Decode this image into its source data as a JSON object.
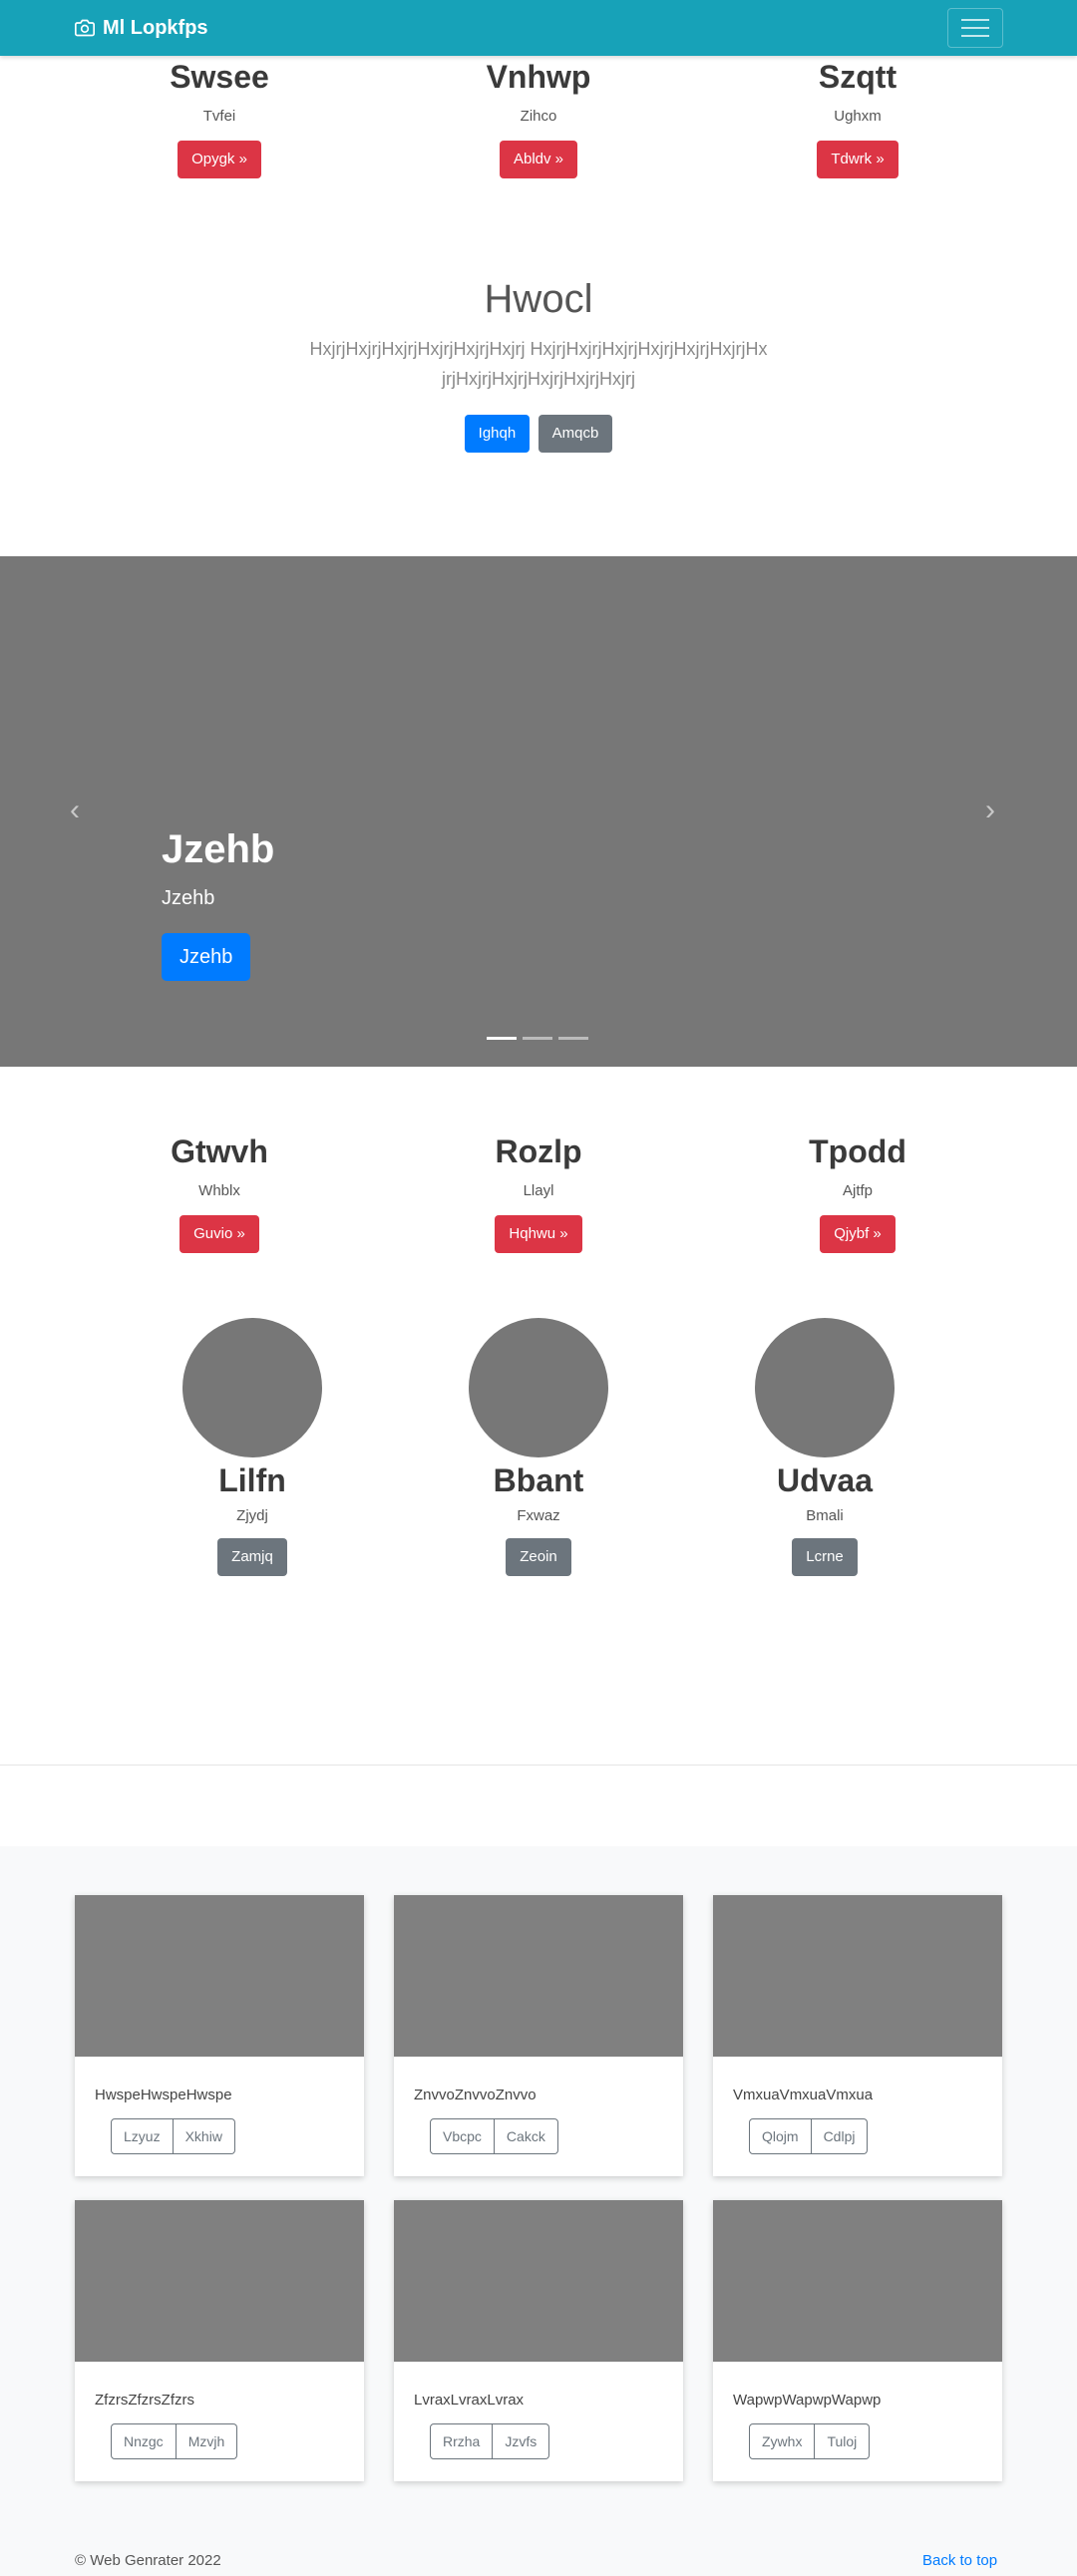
{
  "navbar": {
    "brand": "Ml Lopkfps"
  },
  "top_features": [
    {
      "heading": "Swsee",
      "text": "Tvfei",
      "button": "Opygk »"
    },
    {
      "heading": "Vnhwp",
      "text": "Zihco",
      "button": "Abldv »"
    },
    {
      "heading": "Szqtt",
      "text": "Ughxm",
      "button": "Tdwrk »"
    }
  ],
  "jumbotron": {
    "title": "Hwocl",
    "text": "HxjrjHxjrjHxjrjHxjrjHxjrjHxjrj HxjrjHxjrjHxjrjHxjrjHxjrjHxjrjHxjrjHxjrjHxjrjHxjrjHxjrjHxjrj",
    "primary_button": "Ighqh",
    "secondary_button": "Amqcb"
  },
  "carousel": {
    "title": "Jzehb",
    "subtitle": "Jzehb",
    "button": "Jzehb",
    "prev_glyph": "‹",
    "next_glyph": "›"
  },
  "middle_features": [
    {
      "heading": "Gtwvh",
      "text": "Whblx",
      "button": "Guvio »"
    },
    {
      "heading": "Rozlp",
      "text": "Llayl",
      "button": "Hqhwu »"
    },
    {
      "heading": "Tpodd",
      "text": "Ajtfp",
      "button": "Qjybf »"
    }
  ],
  "team": [
    {
      "name": "Lilfn",
      "role": "Zjydj",
      "button": "Zamjq"
    },
    {
      "name": "Bbant",
      "role": "Fxwaz",
      "button": "Zeoin"
    },
    {
      "name": "Udvaa",
      "role": "Bmali",
      "button": "Lcrne"
    }
  ],
  "cards": [
    {
      "text": "HwspeHwspeHwspe",
      "btn1": "Lzyuz",
      "btn2": "Xkhiw"
    },
    {
      "text": "ZnvvoZnvvoZnvvo",
      "btn1": "Vbcpc",
      "btn2": "Cakck"
    },
    {
      "text": "VmxuaVmxuaVmxua",
      "btn1": "Qlojm",
      "btn2": "Cdlpj"
    },
    {
      "text": "ZfzrsZfzrsZfzrs",
      "btn1": "Nnzgc",
      "btn2": "Mzvjh"
    },
    {
      "text": "LvraxLvraxLvrax",
      "btn1": "Rrzha",
      "btn2": "Jzvfs"
    },
    {
      "text": "WapwpWapwpWapwp",
      "btn1": "Zywhx",
      "btn2": "Tuloj"
    }
  ],
  "footer": {
    "copyright": "© Web Genrater 2022",
    "back_to_top": "Back to top"
  },
  "colors": {
    "navbar": "#17a2b8",
    "danger": "#dc3545",
    "primary": "#007bff",
    "secondary": "#6c757d",
    "placeholder": "#777777"
  }
}
